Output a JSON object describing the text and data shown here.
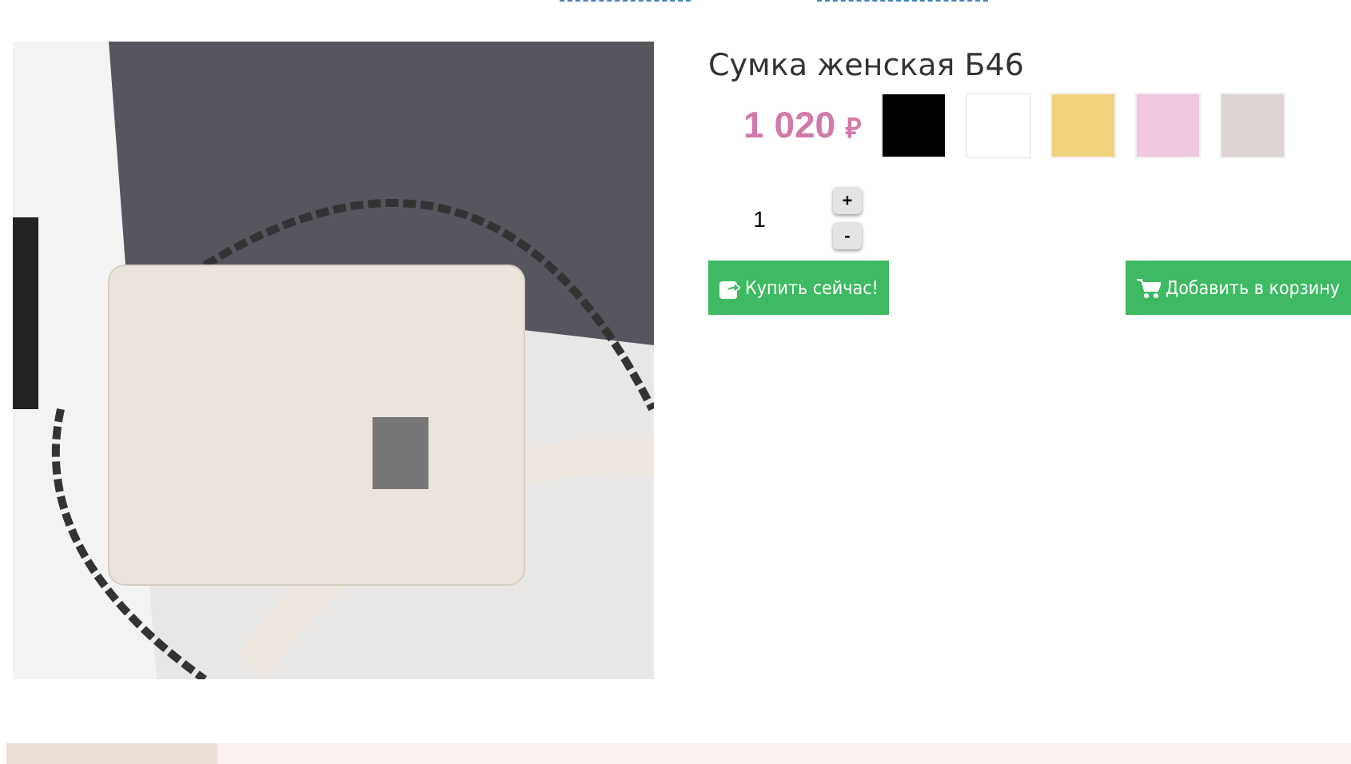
{
  "product": {
    "title": "Сумка женская Б46",
    "price": "1 020",
    "currency": "₽"
  },
  "swatches": [
    {
      "color": "#000000"
    },
    {
      "color": "#ffffff"
    },
    {
      "color": "#f1d27a"
    },
    {
      "color": "#f0c8e0"
    },
    {
      "color": "#ded4d4"
    }
  ],
  "quantity": {
    "value": "1",
    "increment": "+",
    "decrement": "-"
  },
  "buttons": [
    {
      "kind": "buy",
      "label": "Купить сейчас!"
    },
    {
      "kind": "cart",
      "label": "Добавить в корзину"
    }
  ]
}
